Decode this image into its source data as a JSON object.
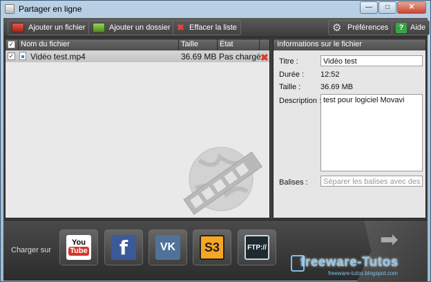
{
  "window": {
    "title": "Partager en ligne",
    "controls": {
      "minimize": "—",
      "maximize": "□",
      "close": "✕"
    }
  },
  "toolbar": {
    "add_file": "Ajouter un fichier",
    "add_folder": "Ajouter un dossier",
    "clear_list": "Effacer la liste",
    "preferences": "Préférences",
    "help": "Aide",
    "help_icon_text": "?"
  },
  "filelist": {
    "columns": {
      "name": "Nom du fichier",
      "size": "Taille",
      "state": "État"
    },
    "rows": [
      {
        "checked": "✓",
        "name": "Vidéo test.mp4",
        "size": "36.69 MB",
        "state": "Pas chargé",
        "remove": "✖"
      }
    ],
    "header_check": "✓"
  },
  "info": {
    "heading": "Informations sur le fichier",
    "title_label": "Titre :",
    "title_value": "Vidéo test",
    "duration_label": "Durée :",
    "duration_value": "12:52",
    "size_label": "Taille :",
    "size_value": "36.69 MB",
    "description_label": "Description :",
    "description_value": "test pour logiciel Movavi",
    "tags_label": "Balises :",
    "tags_placeholder": "Séparer les balises avec des vi..."
  },
  "share": {
    "label": "Charger sur",
    "youtube_you": "You",
    "youtube_tube": "Tube",
    "facebook": "f",
    "vk": "VK",
    "s3": "S3",
    "ftp": "FTP://",
    "send_arrow": "➡"
  },
  "watermark": {
    "main": "freeware-Tutos",
    "sub": "freeware-tutos.blogspot.com"
  }
}
